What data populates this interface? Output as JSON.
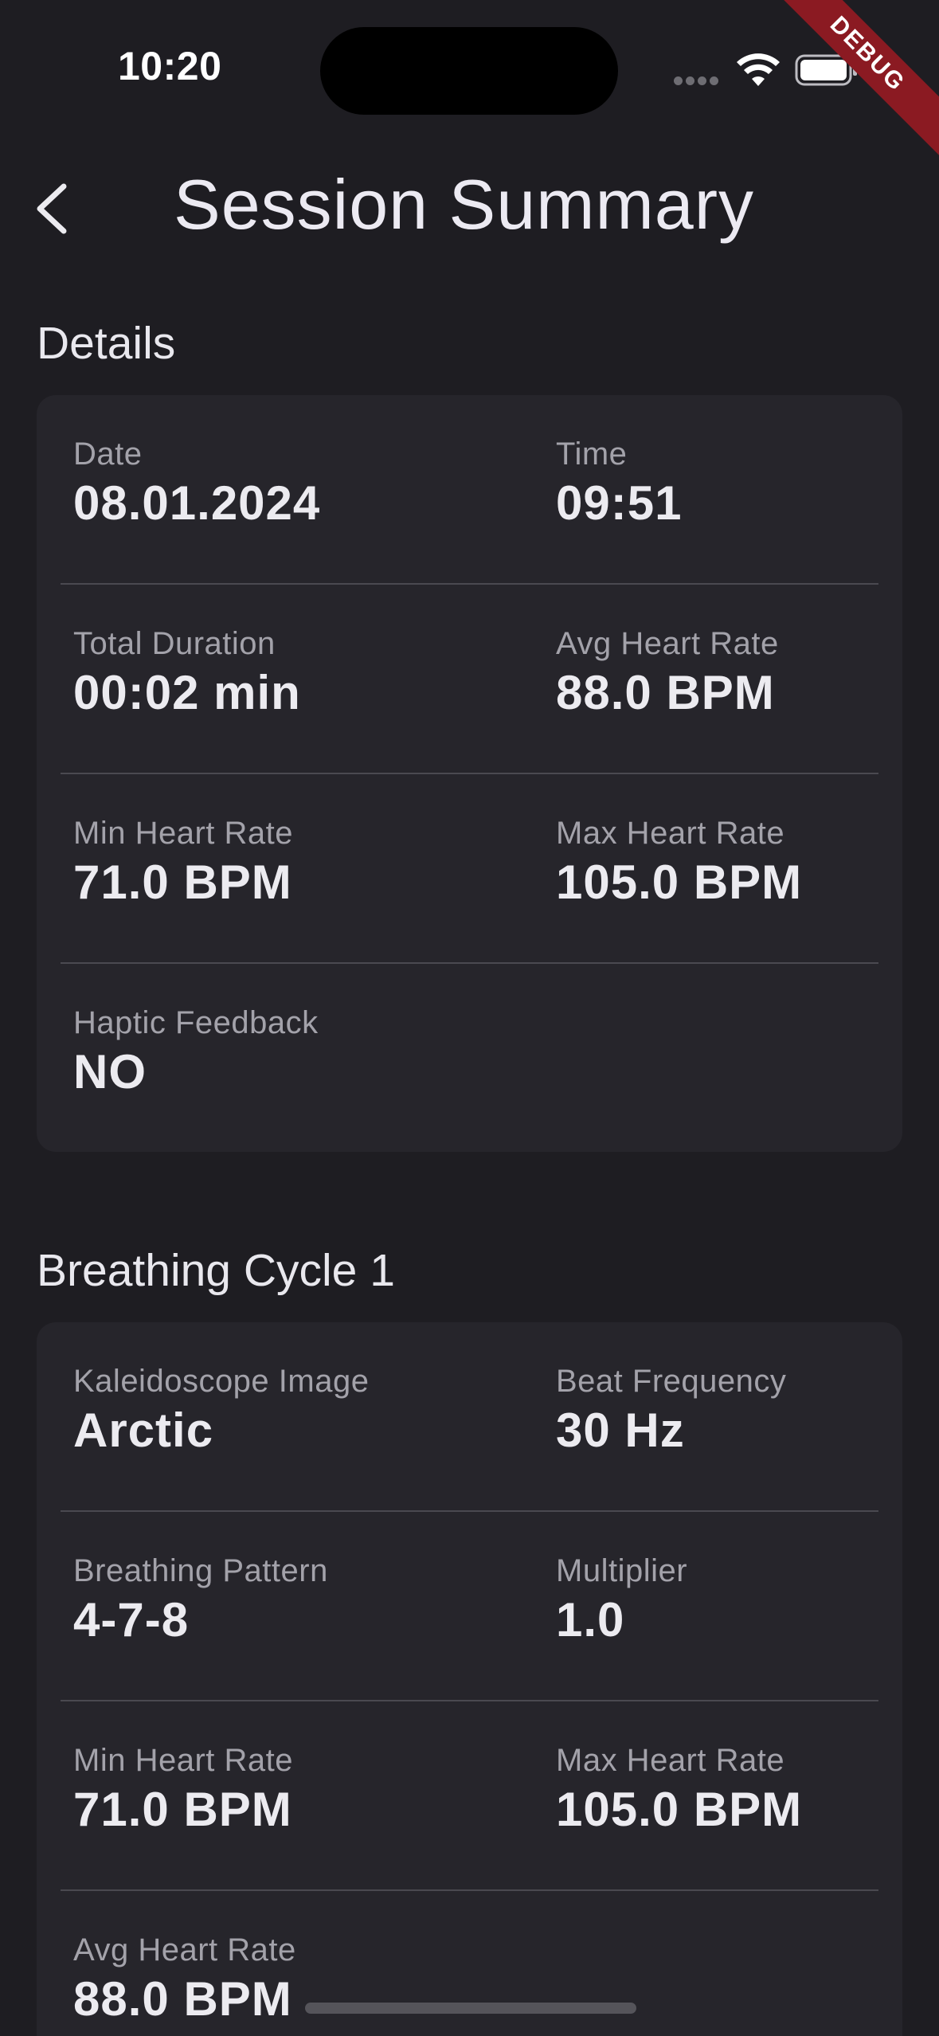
{
  "status_bar": {
    "time": "10:20",
    "debug_label": "DEBUG"
  },
  "header": {
    "title": "Session Summary"
  },
  "details": {
    "section_title": "Details",
    "rows": [
      {
        "left": {
          "label": "Date",
          "value": "08.01.2024"
        },
        "right": {
          "label": "Time",
          "value": "09:51"
        }
      },
      {
        "left": {
          "label": "Total Duration",
          "value": "00:02 min"
        },
        "right": {
          "label": "Avg Heart Rate",
          "value": "88.0 BPM"
        }
      },
      {
        "left": {
          "label": "Min Heart Rate",
          "value": "71.0 BPM"
        },
        "right": {
          "label": "Max Heart Rate",
          "value": "105.0 BPM"
        }
      },
      {
        "left": {
          "label": "Haptic Feedback",
          "value": "NO"
        }
      }
    ]
  },
  "cycle": {
    "section_title": "Breathing Cycle 1",
    "rows": [
      {
        "left": {
          "label": "Kaleidoscope Image",
          "value": "Arctic"
        },
        "right": {
          "label": "Beat Frequency",
          "value": "30 Hz"
        }
      },
      {
        "left": {
          "label": "Breathing Pattern",
          "value": "4-7-8"
        },
        "right": {
          "label": "Multiplier",
          "value": "1.0"
        }
      },
      {
        "left": {
          "label": "Min Heart Rate",
          "value": "71.0 BPM"
        },
        "right": {
          "label": "Max Heart Rate",
          "value": "105.0 BPM"
        }
      },
      {
        "left": {
          "label": "Avg Heart Rate",
          "value": "88.0 BPM"
        }
      }
    ]
  },
  "icons": {
    "back": "chevron-left-icon",
    "wifi": "wifi-icon",
    "battery": "battery-icon",
    "signal": "cellular-signal-icon"
  },
  "colors": {
    "background": "#1e1d22",
    "card": "#26252b",
    "divider": "#4a4950",
    "label": "#a3a2aa",
    "value": "#ecebf0",
    "debug_ribbon": "#8b1a22"
  }
}
